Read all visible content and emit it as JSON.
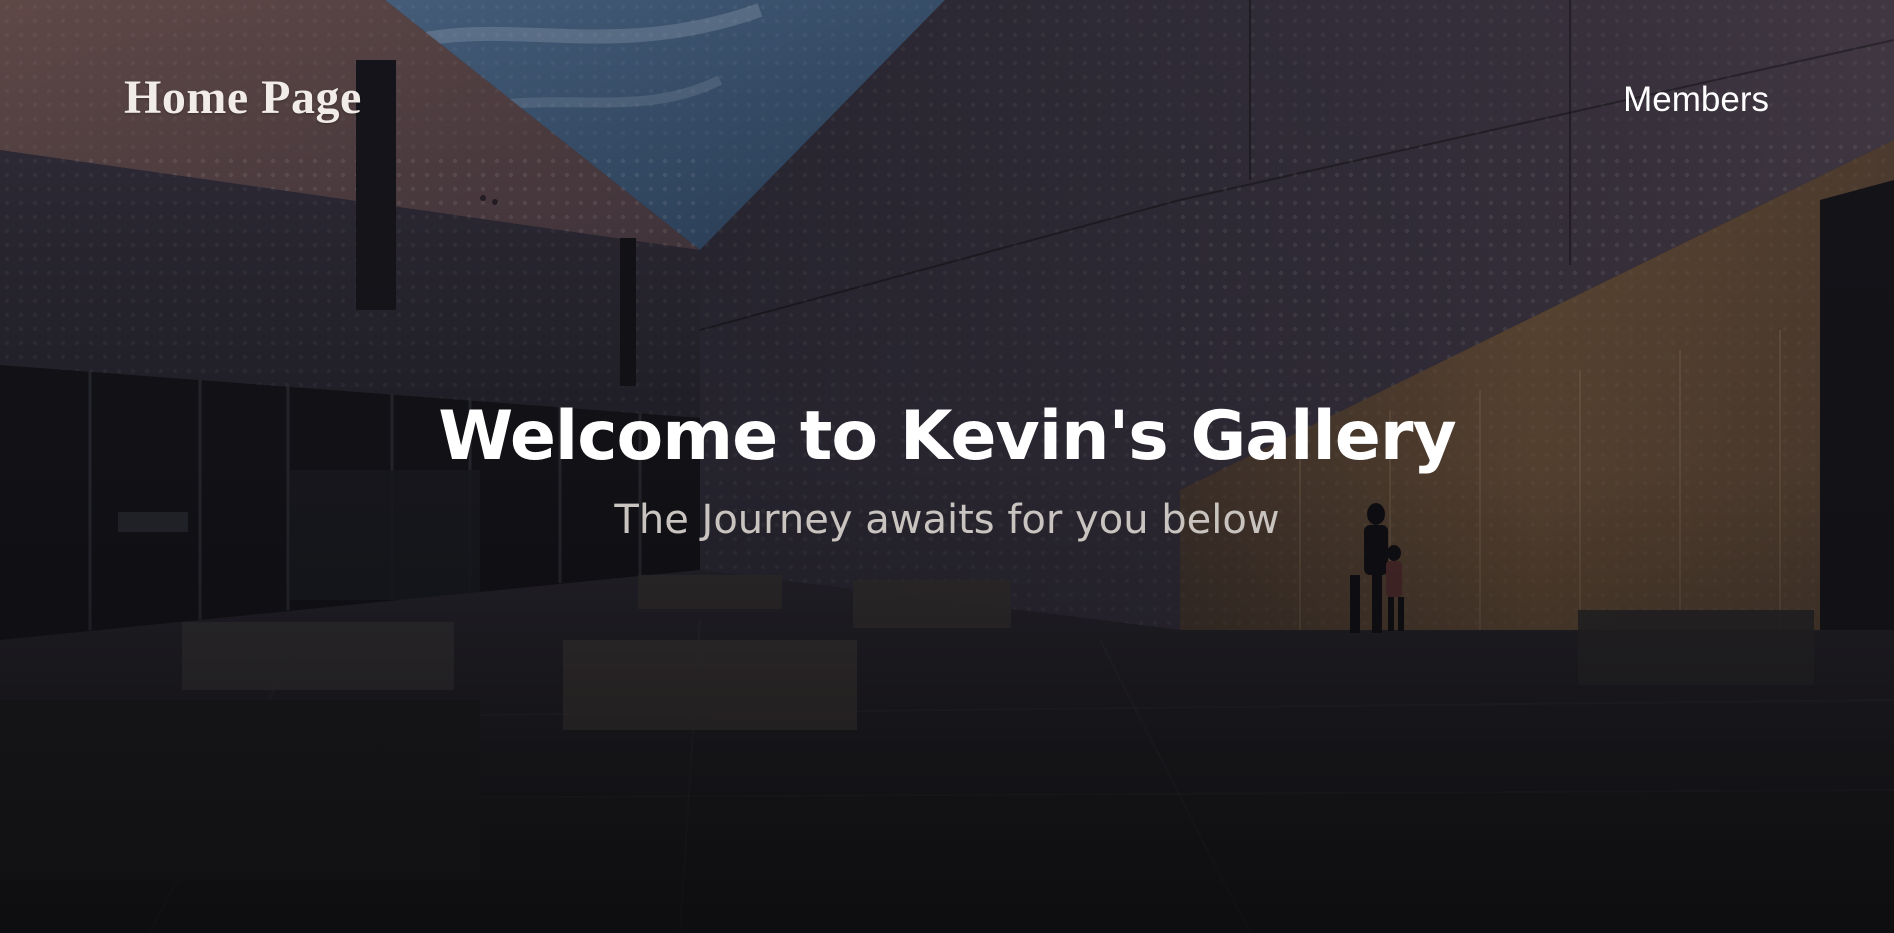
{
  "header": {
    "brand_label": "Home Page",
    "nav": {
      "members_label": "Members"
    }
  },
  "hero": {
    "title": "Welcome to Kevin's Gallery",
    "subtitle": "The Journey awaits for you below",
    "background_image": "museum-courtyard-photo"
  },
  "colors": {
    "title_text": "#ffffff",
    "subtitle_text": "#c9c4bf",
    "brand_text": "#f1ece7",
    "overlay": "#141416"
  }
}
